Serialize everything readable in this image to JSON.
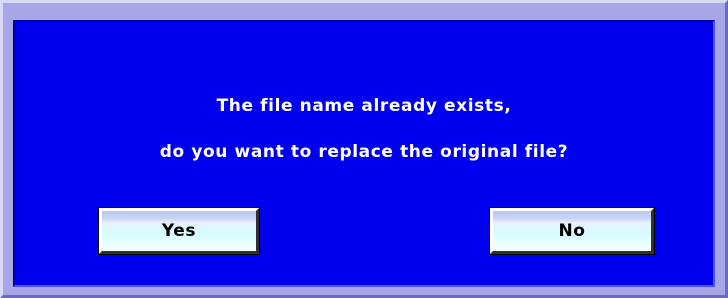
{
  "dialog": {
    "message_line_1": "The file name already exists,",
    "message_line_2": "do you want to replace the original file?",
    "yes_label": "Yes",
    "no_label": "No"
  },
  "colors": {
    "frame": "#a7a7e8",
    "body": "#0000ee",
    "text": "#ffffff",
    "button_text": "#000000"
  }
}
